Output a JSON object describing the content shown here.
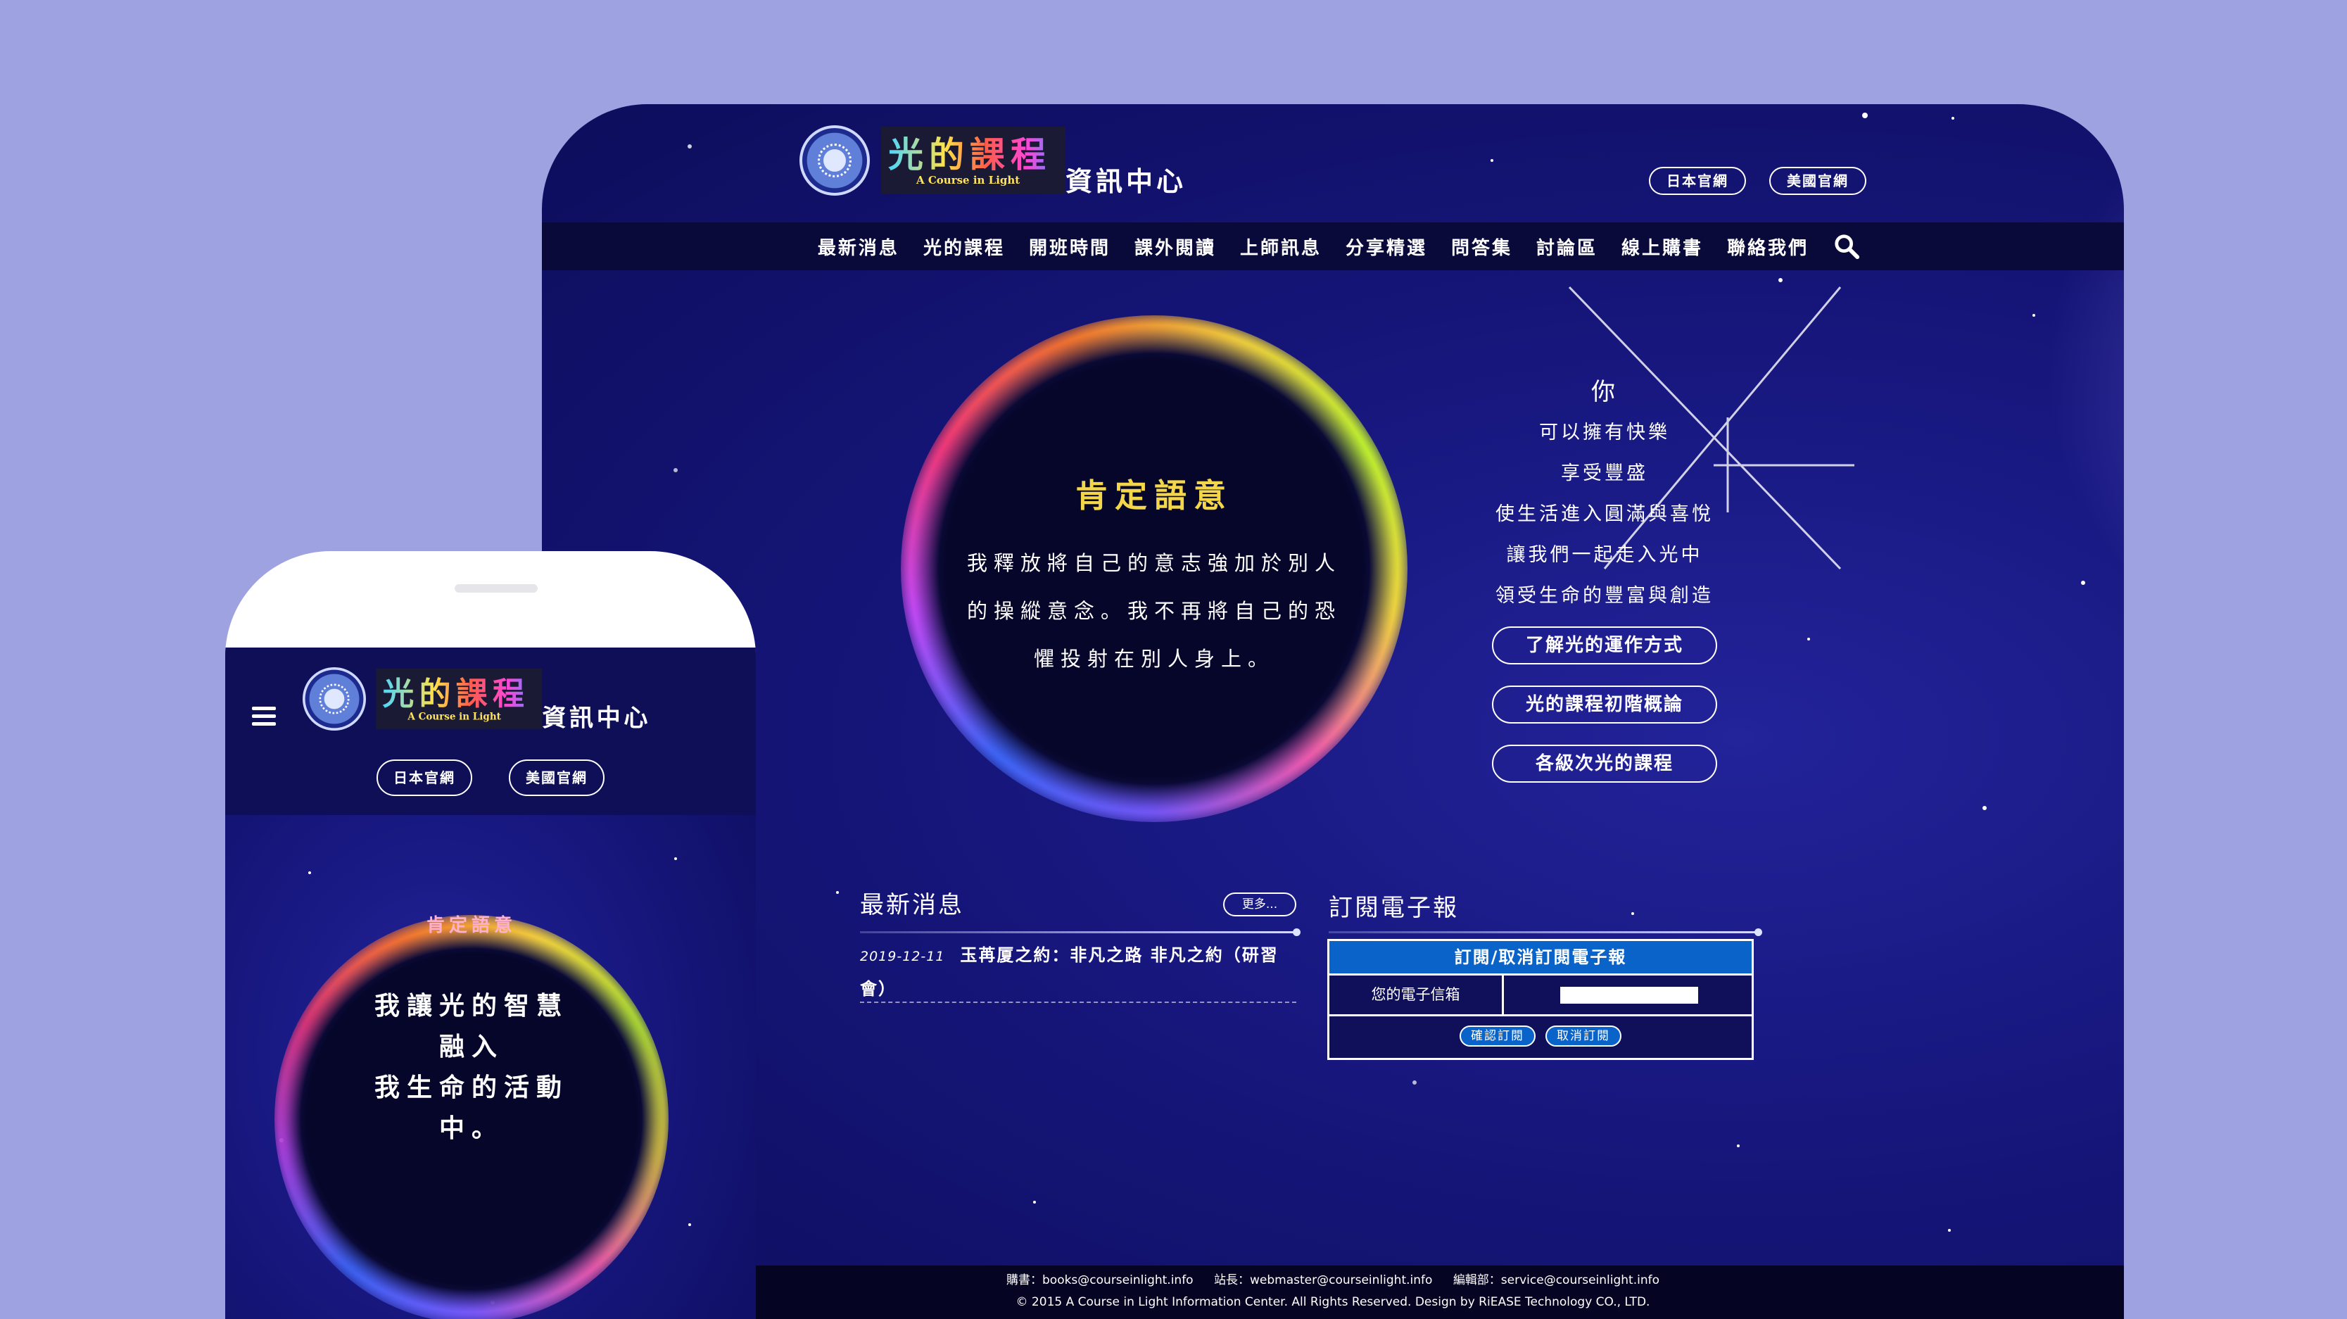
{
  "site": {
    "logo_cn": "光的課程",
    "logo_en": "A Course in Light",
    "logo_sub": "資訊中心",
    "japan_site": "日本官網",
    "us_site": "美國官網"
  },
  "nav": [
    "最新消息",
    "光的課程",
    "開班時間",
    "課外閱讀",
    "上師訊息",
    "分享精選",
    "問答集",
    "討論區",
    "線上購書",
    "聯絡我們"
  ],
  "icons": {
    "search": "search-icon",
    "menu": "hamburger-menu-icon",
    "logo": "flower-of-life-seal-icon"
  },
  "affirmation": {
    "title": "肯定語意",
    "lines": [
      "我釋放將自己的意志強加於別人",
      "的操縱意念。我不再將自己的恐",
      "懼投射在別人身上。"
    ]
  },
  "intro": {
    "lines": [
      "你",
      "可以擁有快樂",
      "享受豐盛",
      "使生活進入圓滿與喜悅",
      "讓我們一起走入光中",
      "領受生命的豐富與創造"
    ],
    "buttons": [
      "了解光的運作方式",
      "光的課程初階概論",
      "各級次光的課程"
    ]
  },
  "news": {
    "title": "最新消息",
    "more": "更多...",
    "items": [
      {
        "date": "2019-12-11",
        "title_line1": "玉苒厦之約：非凡之路 非凡之約（研習",
        "title_line2": "會）"
      }
    ]
  },
  "newsletter": {
    "title": "訂閱電子報",
    "table_head": "訂閱/取消訂閱電子報",
    "email_label": "您的電子信箱",
    "email_value": "",
    "subscribe": "確認訂閱",
    "unsubscribe": "取消訂閱"
  },
  "footer": {
    "contacts": [
      "購書：books@courseinlight.info",
      "站長：webmaster@courseinlight.info",
      "編輯部：service@courseinlight.info"
    ],
    "copyright": "© 2015 A Course in Light Information Center. All Rights Reserved. Design by RiEASE Technology CO., LTD."
  },
  "mobile": {
    "affirmation_title": "肯定語意",
    "lines": [
      "我讓光的智慧",
      "融入",
      "我生命的活動",
      "中。"
    ]
  },
  "colors": {
    "page_bg": "#9ea2e0",
    "site_bg": "#16167c",
    "nav_bg": "#0a0a3a",
    "accent_blue": "#0a63c8",
    "affirmation_gold": "#f3d64a"
  }
}
